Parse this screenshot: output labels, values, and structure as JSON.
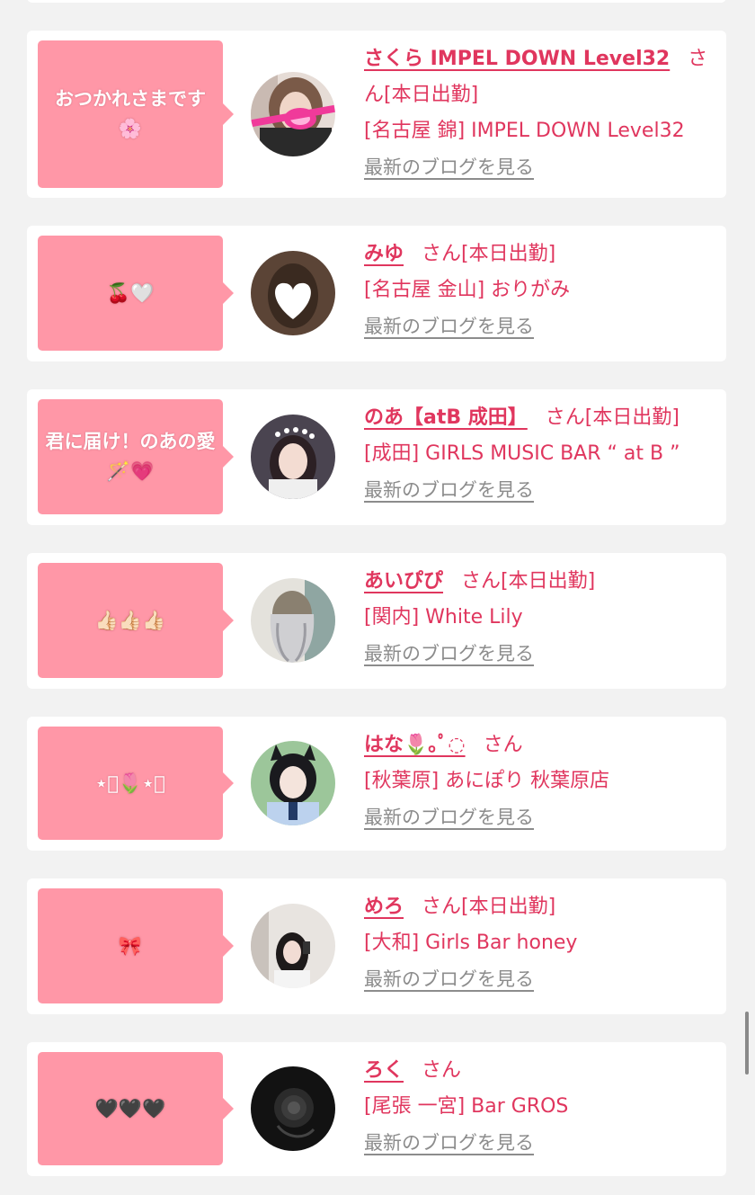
{
  "posts": [
    {
      "message": "おつかれさまです🌸",
      "name": "さくら IMPEL DOWN Level32",
      "suffix": "さん[本日出勤]",
      "shop": "[名古屋 錦] IMPEL DOWN Level32",
      "blog_link": "最新のブログを見る",
      "avatar": "photo-pink-badge"
    },
    {
      "message": "🍒🤍",
      "name": "みゆ",
      "suffix": "さん[本日出勤]",
      "shop": "[名古屋 金山] おりがみ",
      "blog_link": "最新のブログを見る",
      "avatar": "photo-heart-face"
    },
    {
      "message": "君に届け！のあの愛🪄💗",
      "name": "のあ【atB 成田】",
      "suffix": "さん[本日出勤]",
      "shop": "[成田] GIRLS MUSIC BAR “ at B ”",
      "blog_link": "最新のブログを見る",
      "avatar": "photo-girl-tiara"
    },
    {
      "message": "👍🏻👍🏻👍🏻",
      "name": "あいぴぴ",
      "suffix": "さん[本日出勤]",
      "shop": "[関内] White Lily",
      "blog_link": "最新のブログを見る",
      "avatar": "photo-silver-hair"
    },
    {
      "message": "⋆͛🌷⋆͛",
      "name": "はな🌷｡ﾟ◌",
      "suffix": "さん",
      "shop": "[秋葉原] あにぽり 秋葉原店",
      "blog_link": "最新のブログを見る",
      "avatar": "photo-cat-ears"
    },
    {
      "message": "🎀",
      "name": "めろ",
      "suffix": "さん[本日出勤]",
      "shop": "[大和] Girls Bar honey",
      "blog_link": "最新のブログを見る",
      "avatar": "photo-mirror-selfie"
    },
    {
      "message": "🖤🖤🖤",
      "name": "ろく",
      "suffix": "さん",
      "shop": "[尾張 一宮] Bar GROS",
      "blog_link": "最新のブログを見る",
      "avatar": "photo-dark-rose"
    }
  ],
  "colors": {
    "accent": "#e0365e",
    "bubble": "#ff97a7",
    "background": "#f2f2f2",
    "link_gray": "#8c8c8c"
  }
}
